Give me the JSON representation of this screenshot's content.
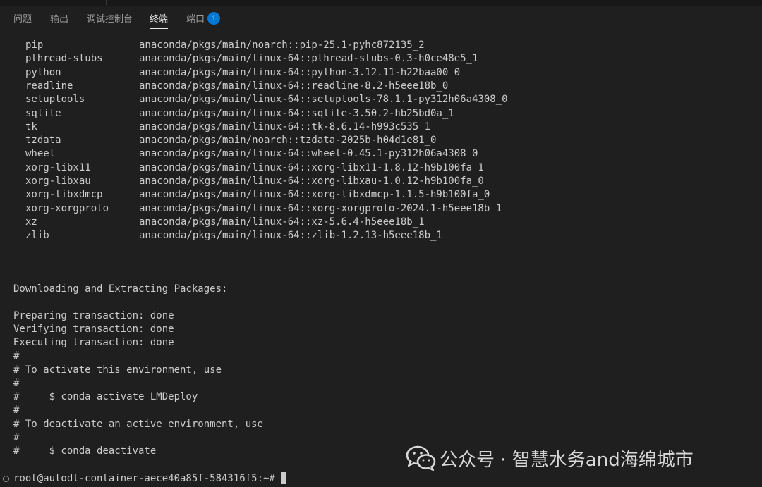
{
  "panel": {
    "tabs": [
      {
        "label": "问题"
      },
      {
        "label": "输出"
      },
      {
        "label": "调试控制台"
      },
      {
        "label": "终端"
      },
      {
        "label": "端口",
        "badge": "1"
      }
    ],
    "active_tab": "终端"
  },
  "terminal": {
    "packages": [
      {
        "name": "pip",
        "spec": "anaconda/pkgs/main/noarch::pip-25.1-pyhc872135_2"
      },
      {
        "name": "pthread-stubs",
        "spec": "anaconda/pkgs/main/linux-64::pthread-stubs-0.3-h0ce48e5_1"
      },
      {
        "name": "python",
        "spec": "anaconda/pkgs/main/linux-64::python-3.12.11-h22baa00_0"
      },
      {
        "name": "readline",
        "spec": "anaconda/pkgs/main/linux-64::readline-8.2-h5eee18b_0"
      },
      {
        "name": "setuptools",
        "spec": "anaconda/pkgs/main/linux-64::setuptools-78.1.1-py312h06a4308_0"
      },
      {
        "name": "sqlite",
        "spec": "anaconda/pkgs/main/linux-64::sqlite-3.50.2-hb25bd0a_1"
      },
      {
        "name": "tk",
        "spec": "anaconda/pkgs/main/linux-64::tk-8.6.14-h993c535_1"
      },
      {
        "name": "tzdata",
        "spec": "anaconda/pkgs/main/noarch::tzdata-2025b-h04d1e81_0"
      },
      {
        "name": "wheel",
        "spec": "anaconda/pkgs/main/linux-64::wheel-0.45.1-py312h06a4308_0"
      },
      {
        "name": "xorg-libx11",
        "spec": "anaconda/pkgs/main/linux-64::xorg-libx11-1.8.12-h9b100fa_1"
      },
      {
        "name": "xorg-libxau",
        "spec": "anaconda/pkgs/main/linux-64::xorg-libxau-1.0.12-h9b100fa_0"
      },
      {
        "name": "xorg-libxdmcp",
        "spec": "anaconda/pkgs/main/linux-64::xorg-libxdmcp-1.1.5-h9b100fa_0"
      },
      {
        "name": "xorg-xorgproto",
        "spec": "anaconda/pkgs/main/linux-64::xorg-xorgproto-2024.1-h5eee18b_1"
      },
      {
        "name": "xz",
        "spec": "anaconda/pkgs/main/linux-64::xz-5.6.4-h5eee18b_1"
      },
      {
        "name": "zlib",
        "spec": "anaconda/pkgs/main/linux-64::zlib-1.2.13-h5eee18b_1"
      }
    ],
    "log": {
      "downloading": "Downloading and Extracting Packages:",
      "preparing": "Preparing transaction: done",
      "verifying": "Verifying transaction: done",
      "executing": "Executing transaction: done",
      "hash1": "#",
      "activate_hint": "# To activate this environment, use",
      "hash2": "#",
      "activate_cmd": "#     $ conda activate LMDeploy",
      "hash3": "#",
      "deactivate_hint": "# To deactivate an active environment, use",
      "hash4": "#",
      "deactivate_cmd": "#     $ conda deactivate"
    },
    "prompt": "root@autodl-container-aece40a85f-584316f5:~#"
  },
  "watermark": {
    "text": "公众号 · 智慧水务and海绵城市"
  },
  "colors": {
    "background": "#1f1f1f",
    "foreground": "#cccccc",
    "badge": "#0078d4"
  }
}
